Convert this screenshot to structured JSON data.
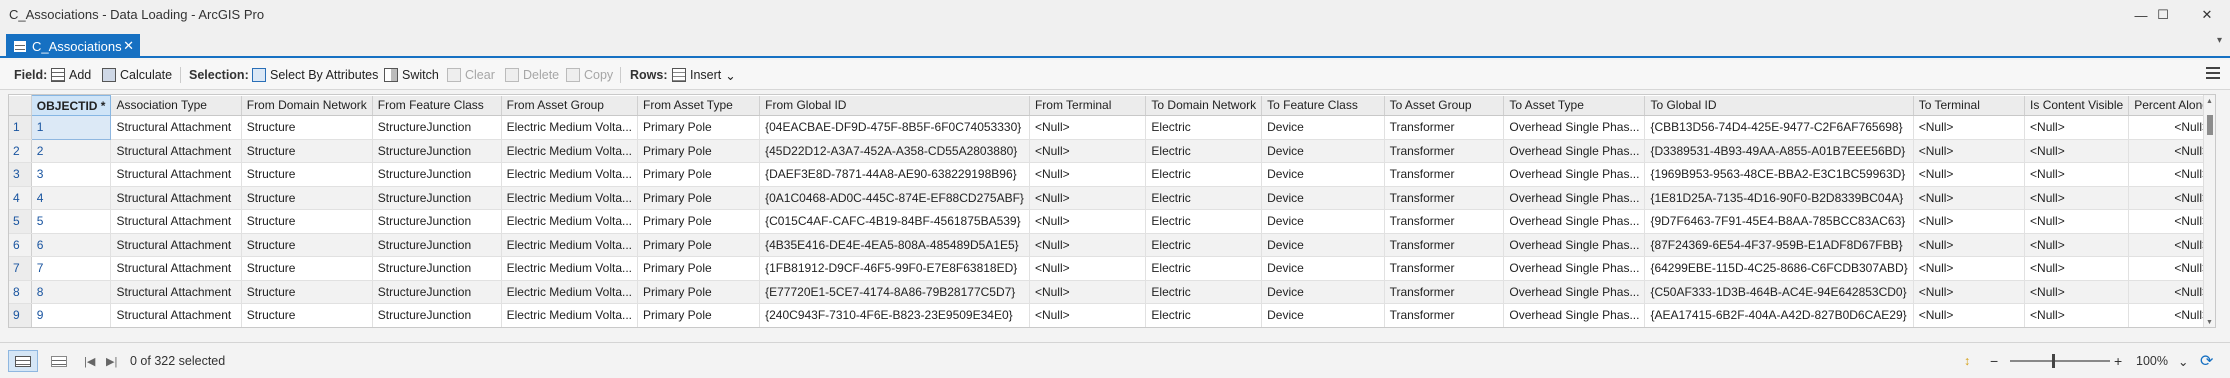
{
  "window": {
    "title": "C_Associations - Data Loading - ArcGIS Pro",
    "minimize_glyph": "—",
    "maximize_glyph": "☐",
    "close_glyph": "✕"
  },
  "tab": {
    "label": "C_Associations",
    "close_glyph": "✕",
    "dropdown_glyph": "▾"
  },
  "toolbar": {
    "field_label": "Field:",
    "add_label": "Add",
    "calculate_label": "Calculate",
    "selection_label": "Selection:",
    "select_by_attributes_label": "Select By Attributes",
    "switch_label": "Switch",
    "clear_label": "Clear",
    "delete_label": "Delete",
    "copy_label": "Copy",
    "rows_label": "Rows:",
    "insert_label": "Insert",
    "insert_caret": "⌄"
  },
  "table": {
    "columns": [
      "OBJECTID *",
      "Association Type",
      "From Domain Network",
      "From Feature Class",
      "From Asset Group",
      "From Asset Type",
      "From Global ID",
      "From Terminal",
      "To Domain Network",
      "To Feature Class",
      "To Asset Group",
      "To Asset Type",
      "To Global ID",
      "To Terminal",
      "Is Content Visible",
      "Percent Along"
    ],
    "rows": [
      [
        "1",
        "1",
        "Structural Attachment",
        "Structure",
        "StructureJunction",
        "Electric Medium Volta...",
        "Primary Pole",
        "{04EACBAE-DF9D-475F-8B5F-6F0C74053330}",
        "<Null>",
        "Electric",
        "Device",
        "Transformer",
        "Overhead Single Phas...",
        "{CBB13D56-74D4-425E-9477-C2F6AF765698}",
        "<Null>",
        "<Null>",
        "<Null>"
      ],
      [
        "2",
        "2",
        "Structural Attachment",
        "Structure",
        "StructureJunction",
        "Electric Medium Volta...",
        "Primary Pole",
        "{45D22D12-A3A7-452A-A358-CD55A2803880}",
        "<Null>",
        "Electric",
        "Device",
        "Transformer",
        "Overhead Single Phas...",
        "{D3389531-4B93-49AA-A855-A01B7EEE56BD}",
        "<Null>",
        "<Null>",
        "<Null>"
      ],
      [
        "3",
        "3",
        "Structural Attachment",
        "Structure",
        "StructureJunction",
        "Electric Medium Volta...",
        "Primary Pole",
        "{DAEF3E8D-7871-44A8-AE90-638229198B96}",
        "<Null>",
        "Electric",
        "Device",
        "Transformer",
        "Overhead Single Phas...",
        "{1969B953-9563-48CE-BBA2-E3C1BC59963D}",
        "<Null>",
        "<Null>",
        "<Null>"
      ],
      [
        "4",
        "4",
        "Structural Attachment",
        "Structure",
        "StructureJunction",
        "Electric Medium Volta...",
        "Primary Pole",
        "{0A1C0468-AD0C-445C-874E-EF88CD275ABF}",
        "<Null>",
        "Electric",
        "Device",
        "Transformer",
        "Overhead Single Phas...",
        "{1E81D25A-7135-4D16-90F0-B2D8339BC04A}",
        "<Null>",
        "<Null>",
        "<Null>"
      ],
      [
        "5",
        "5",
        "Structural Attachment",
        "Structure",
        "StructureJunction",
        "Electric Medium Volta...",
        "Primary Pole",
        "{C015C4AF-CAFC-4B19-84BF-4561875BA539}",
        "<Null>",
        "Electric",
        "Device",
        "Transformer",
        "Overhead Single Phas...",
        "{9D7F6463-7F91-45E4-B8AA-785BCC83AC63}",
        "<Null>",
        "<Null>",
        "<Null>"
      ],
      [
        "6",
        "6",
        "Structural Attachment",
        "Structure",
        "StructureJunction",
        "Electric Medium Volta...",
        "Primary Pole",
        "{4B35E416-DE4E-4EA5-808A-485489D5A1E5}",
        "<Null>",
        "Electric",
        "Device",
        "Transformer",
        "Overhead Single Phas...",
        "{87F24369-6E54-4F37-959B-E1ADF8D67FBB}",
        "<Null>",
        "<Null>",
        "<Null>"
      ],
      [
        "7",
        "7",
        "Structural Attachment",
        "Structure",
        "StructureJunction",
        "Electric Medium Volta...",
        "Primary Pole",
        "{1FB81912-D9CF-46F5-99F0-E7E8F63818ED}",
        "<Null>",
        "Electric",
        "Device",
        "Transformer",
        "Overhead Single Phas...",
        "{64299EBE-115D-4C25-8686-C6FCDB307ABD}",
        "<Null>",
        "<Null>",
        "<Null>"
      ],
      [
        "8",
        "8",
        "Structural Attachment",
        "Structure",
        "StructureJunction",
        "Electric Medium Volta...",
        "Primary Pole",
        "{E77720E1-5CE7-4174-8A86-79B28177C5D7}",
        "<Null>",
        "Electric",
        "Device",
        "Transformer",
        "Overhead Single Phas...",
        "{C50AF333-1D3B-464B-AC4E-94E642853CD0}",
        "<Null>",
        "<Null>",
        "<Null>"
      ],
      [
        "9",
        "9",
        "Structural Attachment",
        "Structure",
        "StructureJunction",
        "Electric Medium Volta...",
        "Primary Pole",
        "{240C943F-7310-4F6E-B823-23E9509E34E0}",
        "<Null>",
        "Electric",
        "Device",
        "Transformer",
        "Overhead Single Phas...",
        "{AEA17415-6B2F-404A-A42D-827B0D6CAE29}",
        "<Null>",
        "<Null>",
        "<Null>"
      ]
    ]
  },
  "status": {
    "first_glyph": "|◀",
    "next_glyph": "▶|",
    "selected_text": "0 of 322 selected",
    "zoom_minus": "−",
    "zoom_plus": "+",
    "zoom_level": "100%",
    "zoom_caret": "⌄",
    "refresh_glyph": "⟳"
  },
  "colors": {
    "accent": "#1670c2",
    "selection": "#dce9f6"
  }
}
